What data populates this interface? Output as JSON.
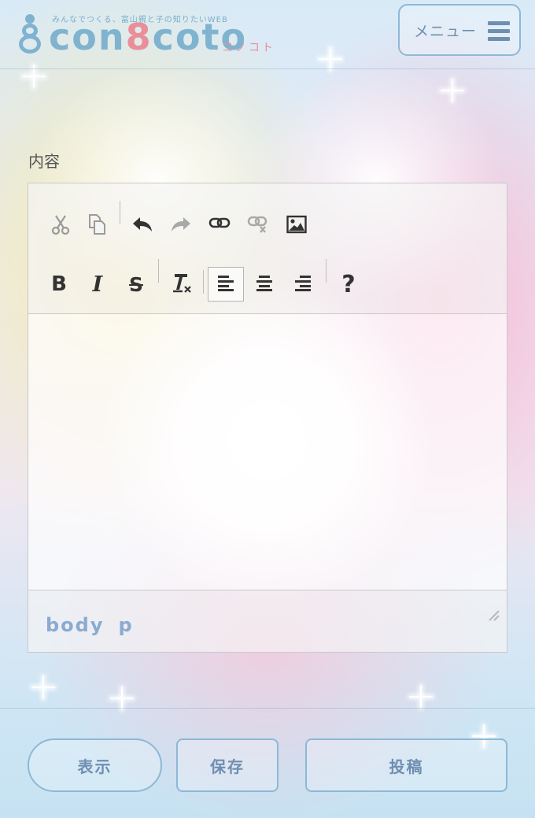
{
  "header": {
    "tagline": "みんなでつくる、富山親と子の知りたいWEB",
    "logo": {
      "prefix": "con",
      "eight": "8",
      "suffix": "coto",
      "kana": "コノコト"
    },
    "menu_label": "メニュー"
  },
  "form": {
    "field_label": "内容"
  },
  "editor": {
    "toolbar_row1": [
      "cut-icon",
      "copy-icon",
      "undo-icon",
      "redo-icon",
      "link-icon",
      "unlink-icon",
      "image-icon"
    ],
    "toolbar_row2": [
      "bold-icon",
      "italic-icon",
      "strikethrough-icon",
      "remove-format-icon",
      "align-left-icon",
      "align-center-icon",
      "align-right-icon",
      "help-icon"
    ],
    "glyphs": {
      "bold": "B",
      "italic": "I",
      "strike": "S",
      "help": "?"
    },
    "content": "",
    "path": [
      "body",
      "p"
    ]
  },
  "buttons": {
    "view": "表示",
    "save": "保存",
    "post": "投稿"
  },
  "colors": {
    "accent": "#6f8fb0",
    "border": "#8db8d6",
    "logo_blue": "#7fb3cf",
    "logo_pink": "#e88f9a"
  }
}
